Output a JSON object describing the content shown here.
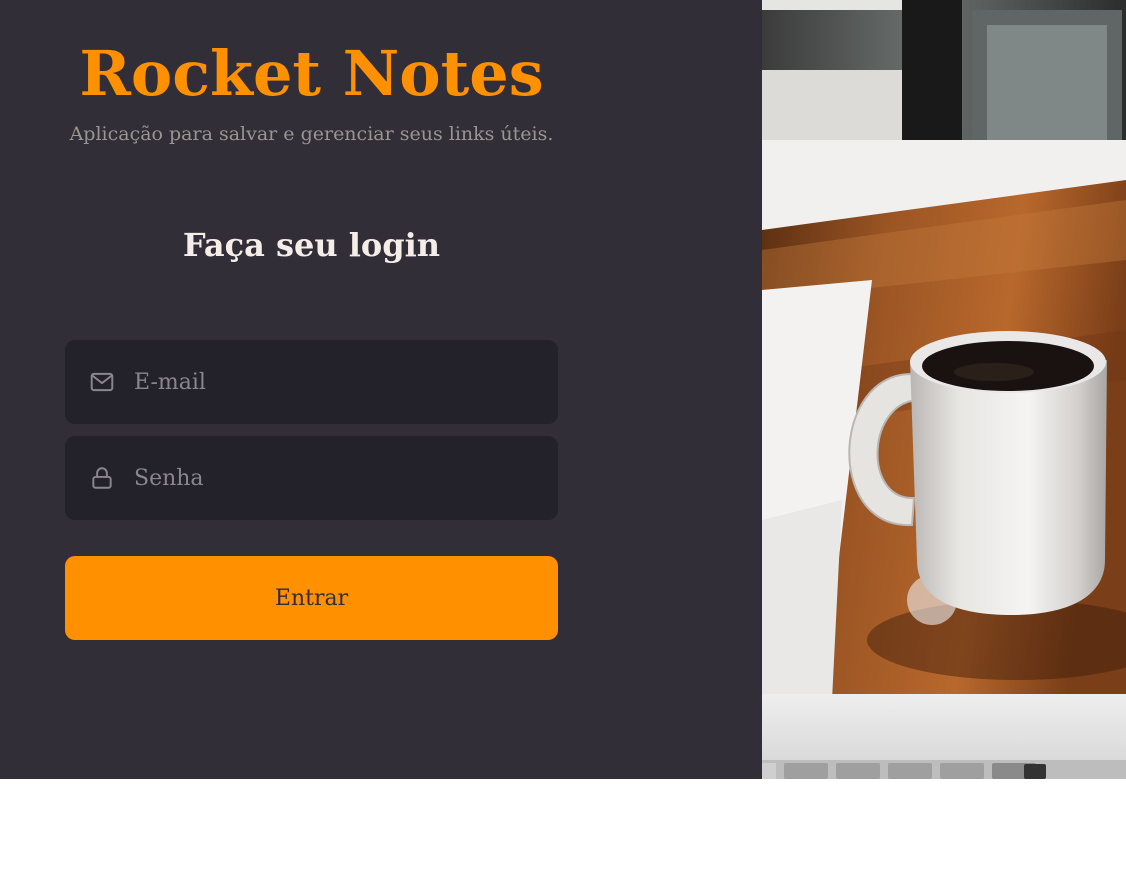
{
  "brand": {
    "title": "Rocket Notes",
    "subtitle": "Aplicação para salvar e gerenciar seus links úteis."
  },
  "login": {
    "heading": "Faça seu login",
    "email_placeholder": "E-mail",
    "email_icon": "mail-icon",
    "password_placeholder": "Senha",
    "password_icon": "lock-icon",
    "submit_label": "Entrar"
  },
  "background_image": {
    "subject": "coffee-mug-photo"
  },
  "colors": {
    "accent": "#ff9000",
    "panel": "#312e38",
    "input_bg": "#232129",
    "heading": "#f4ede8",
    "muted": "#999591"
  }
}
